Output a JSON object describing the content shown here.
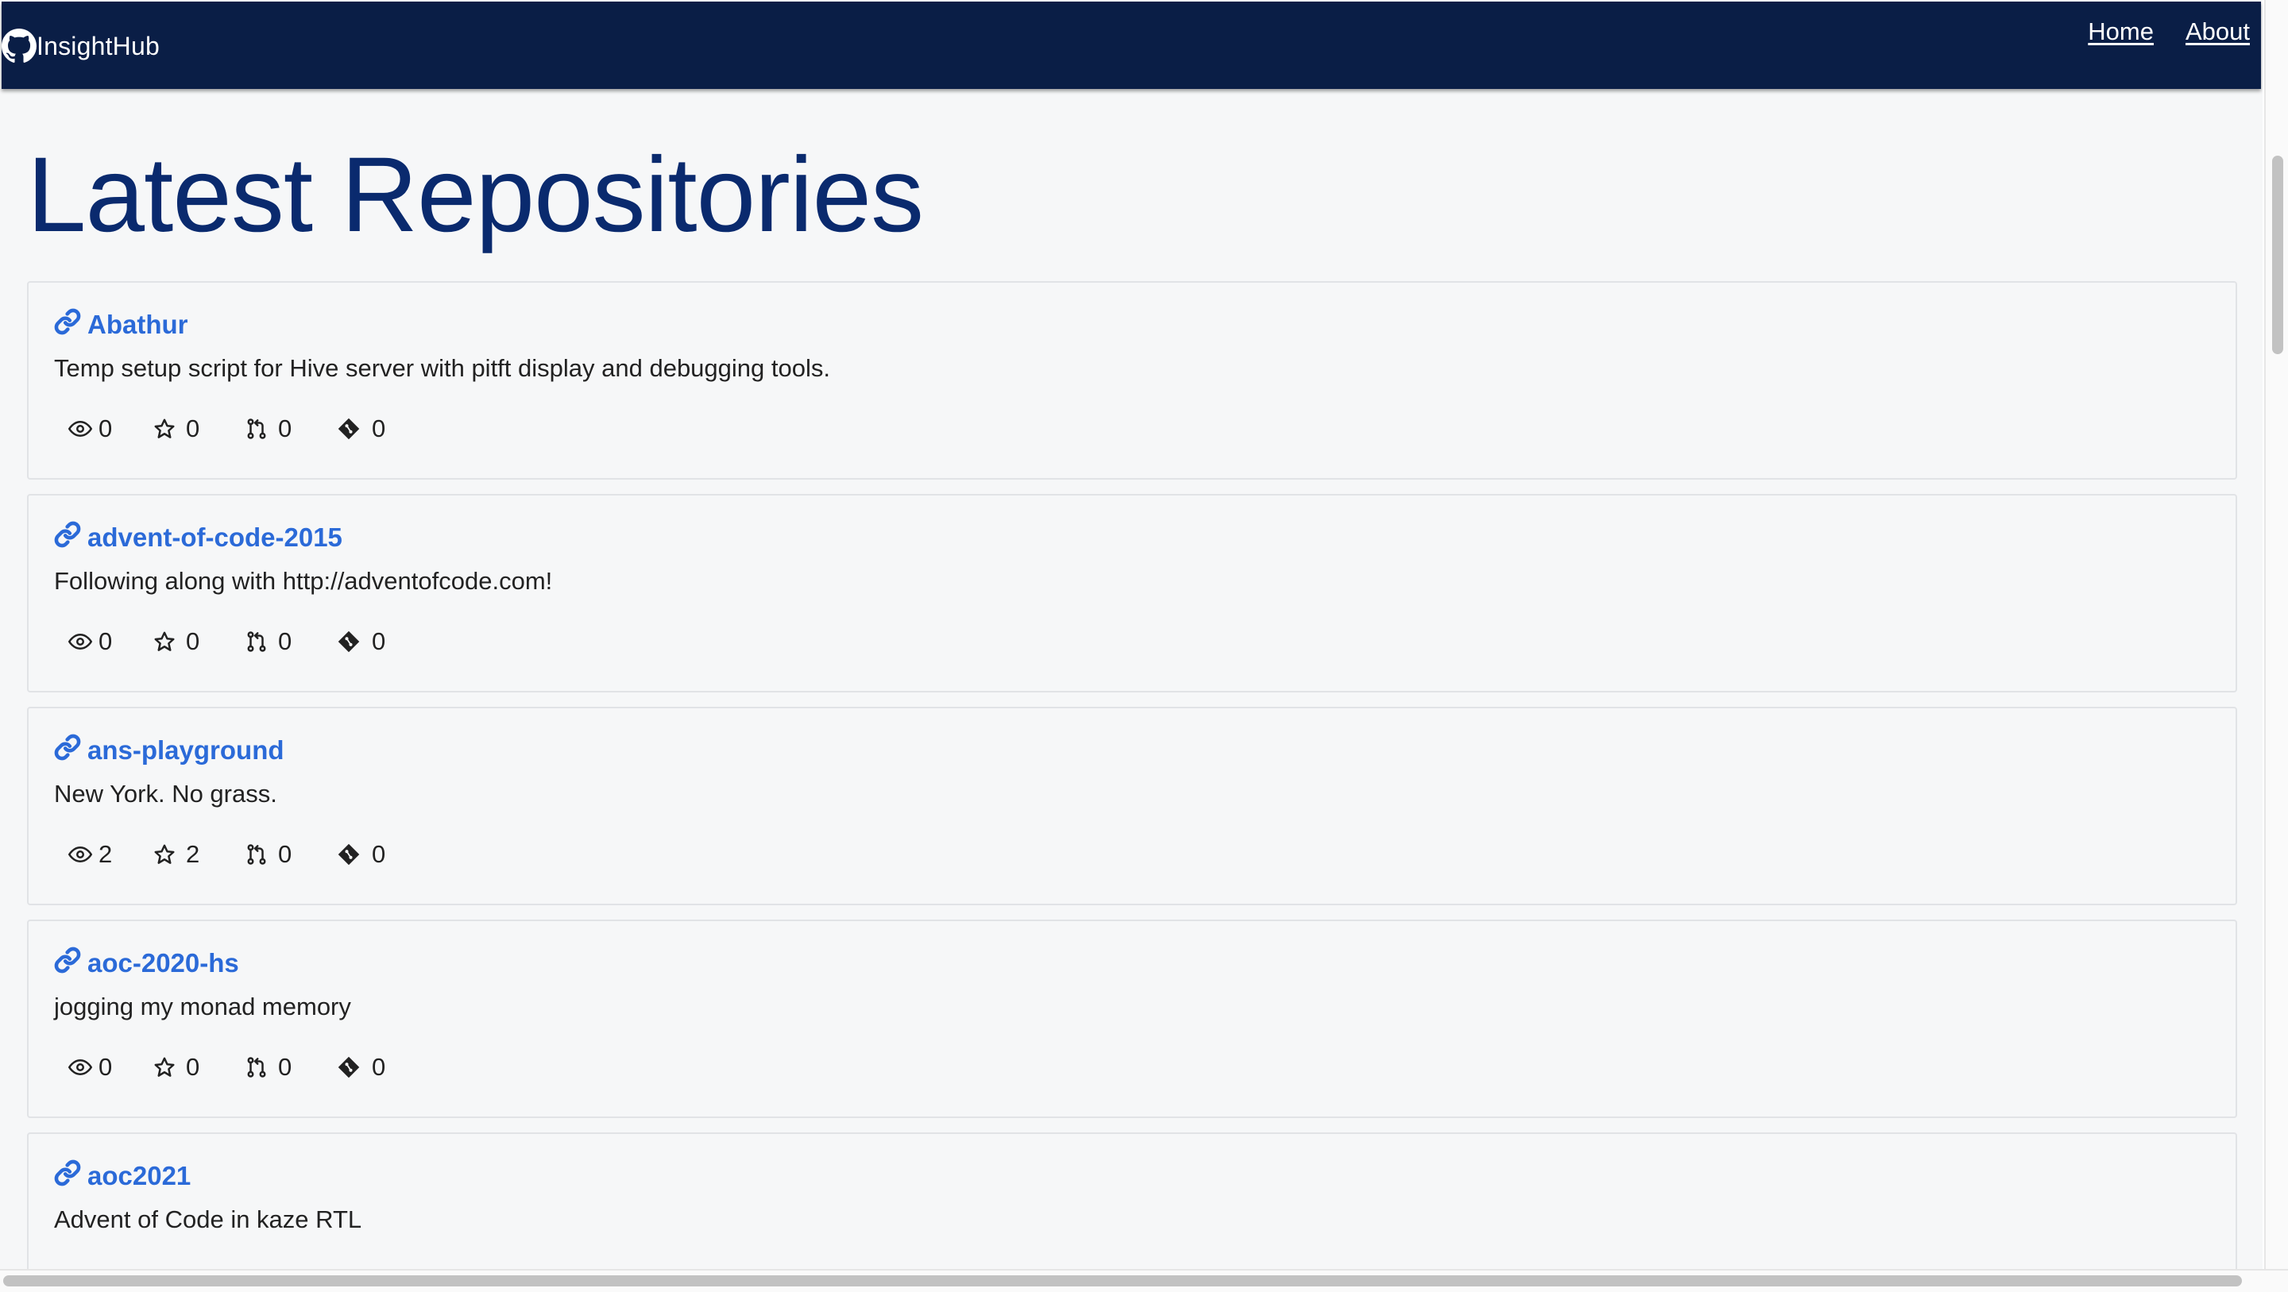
{
  "navbar": {
    "brand": "InsightHub",
    "links": [
      "Home",
      "About"
    ]
  },
  "page": {
    "title": "Latest Repositories"
  },
  "repos": [
    {
      "name": "Abathur",
      "description": "Temp setup script for Hive server with pitft display and debugging tools.",
      "watchers": "0",
      "stars": "0",
      "pull_requests": "0",
      "commits": "0"
    },
    {
      "name": "advent-of-code-2015",
      "description": "Following along with http://adventofcode.com!",
      "watchers": "0",
      "stars": "0",
      "pull_requests": "0",
      "commits": "0"
    },
    {
      "name": "ans-playground",
      "description": "New York. No grass.",
      "watchers": "2",
      "stars": "2",
      "pull_requests": "0",
      "commits": "0"
    },
    {
      "name": "aoc-2020-hs",
      "description": "jogging my monad memory",
      "watchers": "0",
      "stars": "0",
      "pull_requests": "0",
      "commits": "0"
    },
    {
      "name": "aoc2021",
      "description": "Advent of Code in kaze RTL",
      "watchers": "",
      "stars": "",
      "pull_requests": "",
      "commits": ""
    }
  ],
  "icons": {
    "brand": "github-icon",
    "repo_link": "link-icon",
    "watchers": "eye-icon",
    "stars": "star-icon",
    "pull_requests": "pull-request-icon",
    "commits": "git-commit-icon"
  },
  "colors": {
    "navbar_bg": "#0a1e46",
    "title": "#0a2a6e",
    "link": "#2b6ad8",
    "page_bg": "#f6f7f8"
  }
}
